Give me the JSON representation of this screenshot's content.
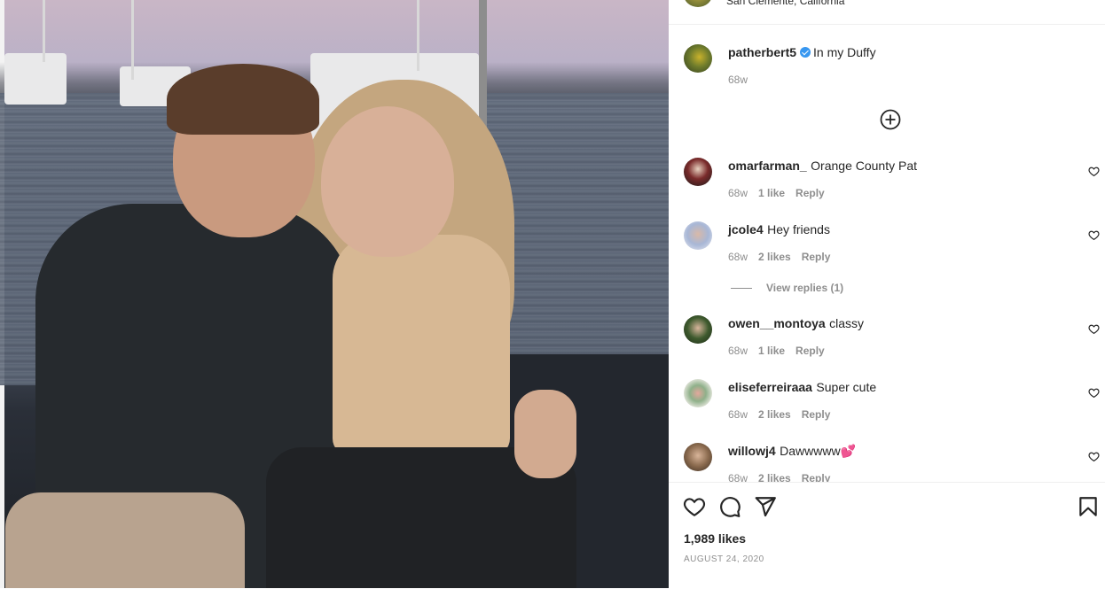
{
  "post": {
    "location": "San Clemente, California",
    "caption": {
      "username": "patherbert5",
      "text": "In my Duffy",
      "time": "68w"
    },
    "comments": [
      {
        "username": "omarfarman_",
        "text": "Orange County Pat",
        "time": "68w",
        "likes": "1 like",
        "reply": "Reply"
      },
      {
        "username": "jcole4",
        "text": "Hey friends",
        "time": "68w",
        "likes": "2 likes",
        "reply": "Reply"
      },
      {
        "username": "owen__montoya",
        "text": "classy",
        "time": "68w",
        "likes": "1 like",
        "reply": "Reply"
      },
      {
        "username": "eliseferreiraaa",
        "text": "Super cute",
        "time": "68w",
        "likes": "2 likes",
        "reply": "Reply"
      },
      {
        "username": "willowj4",
        "text": "Dawwwww💕",
        "time": "68w",
        "likes": "2 likes",
        "reply": "Reply"
      }
    ],
    "view_replies": "View replies (1)",
    "likes_count": "1,989 likes",
    "date": "AUGUST 24, 2020"
  },
  "icons": {
    "load_more": "plus-circle-icon",
    "like": "heart-icon",
    "comment": "comment-bubble-icon",
    "share": "paper-plane-icon",
    "save": "bookmark-icon"
  },
  "colors": {
    "text": "#262626",
    "secondary_text": "#8e8e8e",
    "verified_badge": "#3897f0",
    "divider": "#efefef"
  }
}
